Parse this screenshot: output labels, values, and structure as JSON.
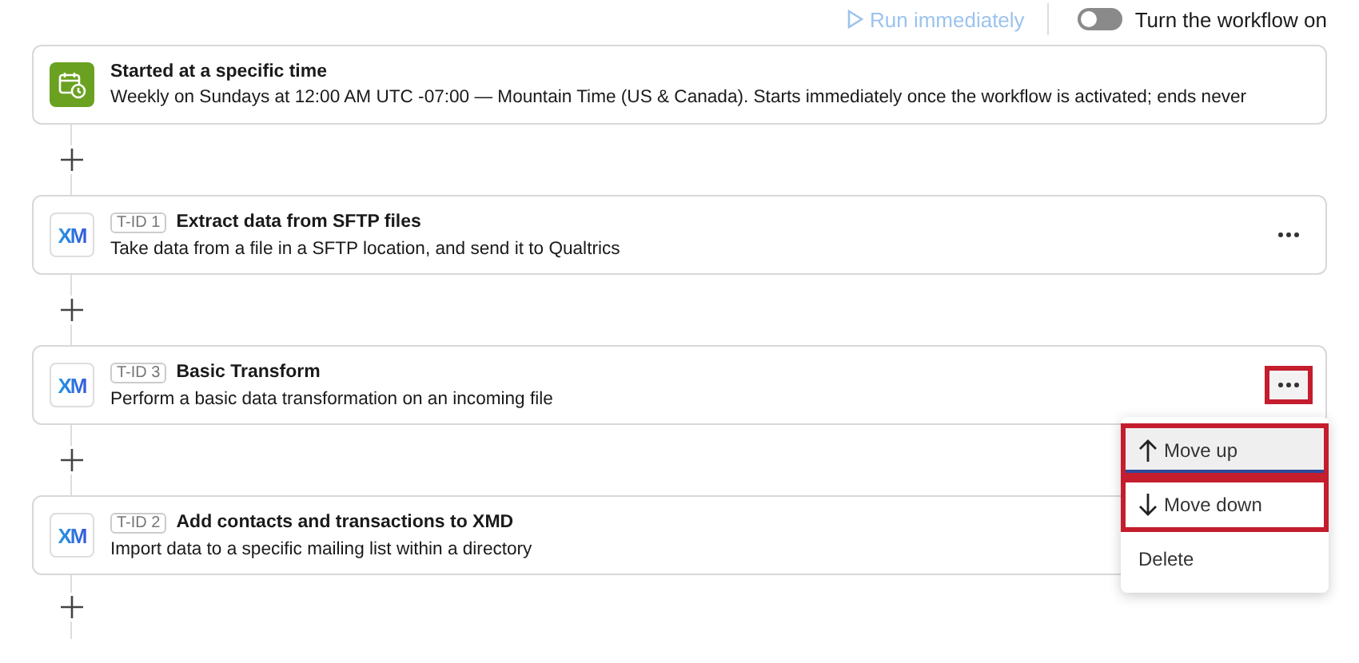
{
  "toolbar": {
    "run_button": {
      "label": "Run immediately",
      "disabled": true
    },
    "toggle": {
      "label": "Turn the workflow on",
      "on": false
    }
  },
  "trigger": {
    "title": "Started at a specific time",
    "description": "Weekly on Sundays at 12:00 AM UTC -07:00 — Mountain Time (US & Canada). Starts immediately once the workflow is activated; ends never"
  },
  "tasks": [
    {
      "logo_text": "XM",
      "tag": "T-ID 1",
      "title": "Extract data from SFTP files",
      "description": "Take data from a file in a SFTP location, and send it to Qualtrics",
      "menu_highlighted": false,
      "menu_open": false
    },
    {
      "logo_text": "XM",
      "tag": "T-ID 3",
      "title": "Basic Transform",
      "description": "Perform a basic data transformation on an incoming file",
      "menu_highlighted": true,
      "menu_open": true
    },
    {
      "logo_text": "XM",
      "tag": "T-ID 2",
      "title": "Add contacts and transactions to XMD",
      "description": "Import data to a specific mailing list within a directory"
    }
  ],
  "menu": {
    "items": [
      {
        "kind": "up",
        "label": "Move up",
        "selected": true,
        "highlighted": true
      },
      {
        "kind": "down",
        "label": "Move down",
        "selected": false,
        "highlighted": true
      },
      {
        "kind": "plain",
        "label": "Delete",
        "selected": false,
        "highlighted": false
      }
    ]
  }
}
